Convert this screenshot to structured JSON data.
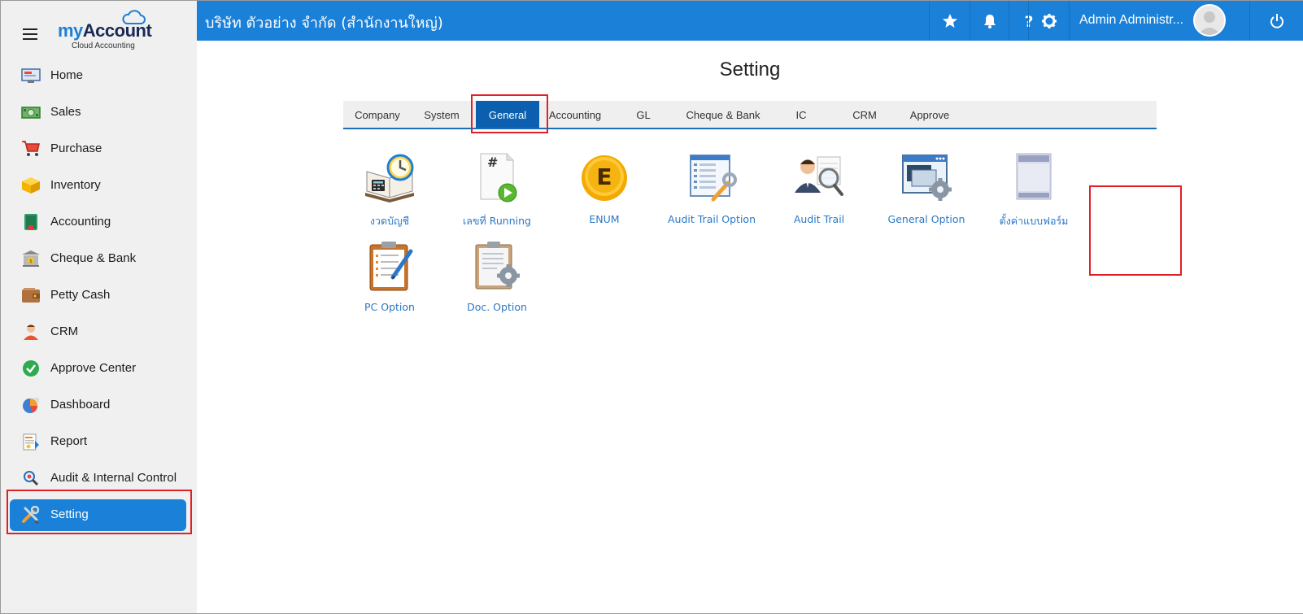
{
  "brand": {
    "logo_my": "my",
    "logo_account": "Account",
    "logo_sub": "Cloud Accounting"
  },
  "sidebar": {
    "items": [
      {
        "label": "Home",
        "icon": "home-icon"
      },
      {
        "label": "Sales",
        "icon": "money-icon"
      },
      {
        "label": "Purchase",
        "icon": "cart-icon"
      },
      {
        "label": "Inventory",
        "icon": "box-icon"
      },
      {
        "label": "Accounting",
        "icon": "book-icon"
      },
      {
        "label": "Cheque & Bank",
        "icon": "bank-icon"
      },
      {
        "label": "Petty Cash",
        "icon": "wallet-icon"
      },
      {
        "label": "CRM",
        "icon": "person-icon"
      },
      {
        "label": "Approve Center",
        "icon": "check-circle-icon"
      },
      {
        "label": "Dashboard",
        "icon": "pie-chart-icon"
      },
      {
        "label": "Report",
        "icon": "report-icon"
      },
      {
        "label": "Audit & Internal Control",
        "icon": "magnifier-icon"
      },
      {
        "label": "Setting",
        "icon": "tools-icon",
        "active": true
      }
    ]
  },
  "topbar": {
    "company": "บริษัท ตัวอย่าง จำกัด (สำนักงานใหญ่)",
    "user_name": "Admin Administr...",
    "icons": [
      "star-icon",
      "bell-icon",
      "help-icon",
      "gear-icon",
      "power-icon"
    ]
  },
  "main": {
    "title": "Setting",
    "tabs": [
      {
        "label": "Company"
      },
      {
        "label": "System"
      },
      {
        "label": "General",
        "active": true
      },
      {
        "label": "Accounting"
      },
      {
        "label": "GL"
      },
      {
        "label": "Cheque & Bank"
      },
      {
        "label": "IC"
      },
      {
        "label": "CRM"
      },
      {
        "label": "Approve"
      }
    ],
    "tiles": [
      {
        "label": "งวดบัญชี",
        "icon": "calendar-clock-icon"
      },
      {
        "label": "เลขที่ Running",
        "icon": "hash-document-icon"
      },
      {
        "label": "ENUM",
        "icon": "enum-coin-icon"
      },
      {
        "label": "Audit Trail Option",
        "icon": "audit-list-icon"
      },
      {
        "label": "Audit Trail",
        "icon": "person-search-icon"
      },
      {
        "label": "General Option",
        "icon": "window-gear-icon"
      },
      {
        "label": "ตั้งค่าแบบฟอร์ม",
        "icon": "form-page-icon"
      },
      {
        "label": "PC Option",
        "icon": "clipboard-pen-icon"
      },
      {
        "label": "Doc. Option",
        "icon": "document-gear-icon"
      }
    ]
  },
  "colors": {
    "accent": "#1a80d8",
    "tab_active": "#0b5fae",
    "highlight": "#e21f26",
    "link": "#2a78c7"
  }
}
